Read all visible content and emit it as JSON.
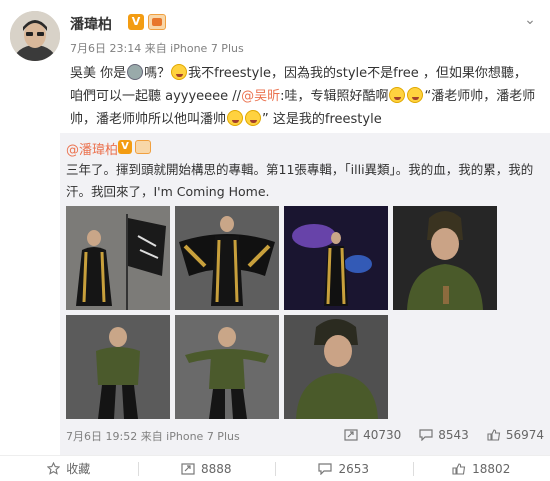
{
  "user": {
    "name": "潘瑋柏",
    "verified_badge": "V",
    "meta": "7月6日 23:14 来自 iPhone 7 Plus"
  },
  "post": {
    "text_before_alien": "吳美 你是",
    "text_after_alien": "嗎？",
    "text_after_tongue": "我不freestyle，因為我的style不是free ，但如果你想聽，咱們可以一起聽 ayyyeeee //",
    "mention": "@吴昕",
    "text_after_mention": ":哇，专辑照好酷啊",
    "quote_part": "“潘老师帅，潘老师帅，潘老师帅所以他叫潘帅",
    "text_end": "” 这是我的freestyle"
  },
  "repost": {
    "author": "@潘瑋柏",
    "verified_badge": "V",
    "text": "三年了。揮到頭就開始構思的專輯。第11張專輯，「illi異類」。我的血，我的累，我的汗。我回來了，I'm Coming Home.",
    "meta": "7月6日 19:52 来自 iPhone 7 Plus",
    "stats": {
      "reposts": "40730",
      "comments": "8543",
      "likes": "56974"
    }
  },
  "actions": {
    "favorite": "收藏",
    "repost": "8888",
    "comment": "2653",
    "like": "18802"
  },
  "colors": {
    "mention": "#eb7350",
    "repost_bg": "#f2f2f5",
    "vip": "#f39c12"
  }
}
